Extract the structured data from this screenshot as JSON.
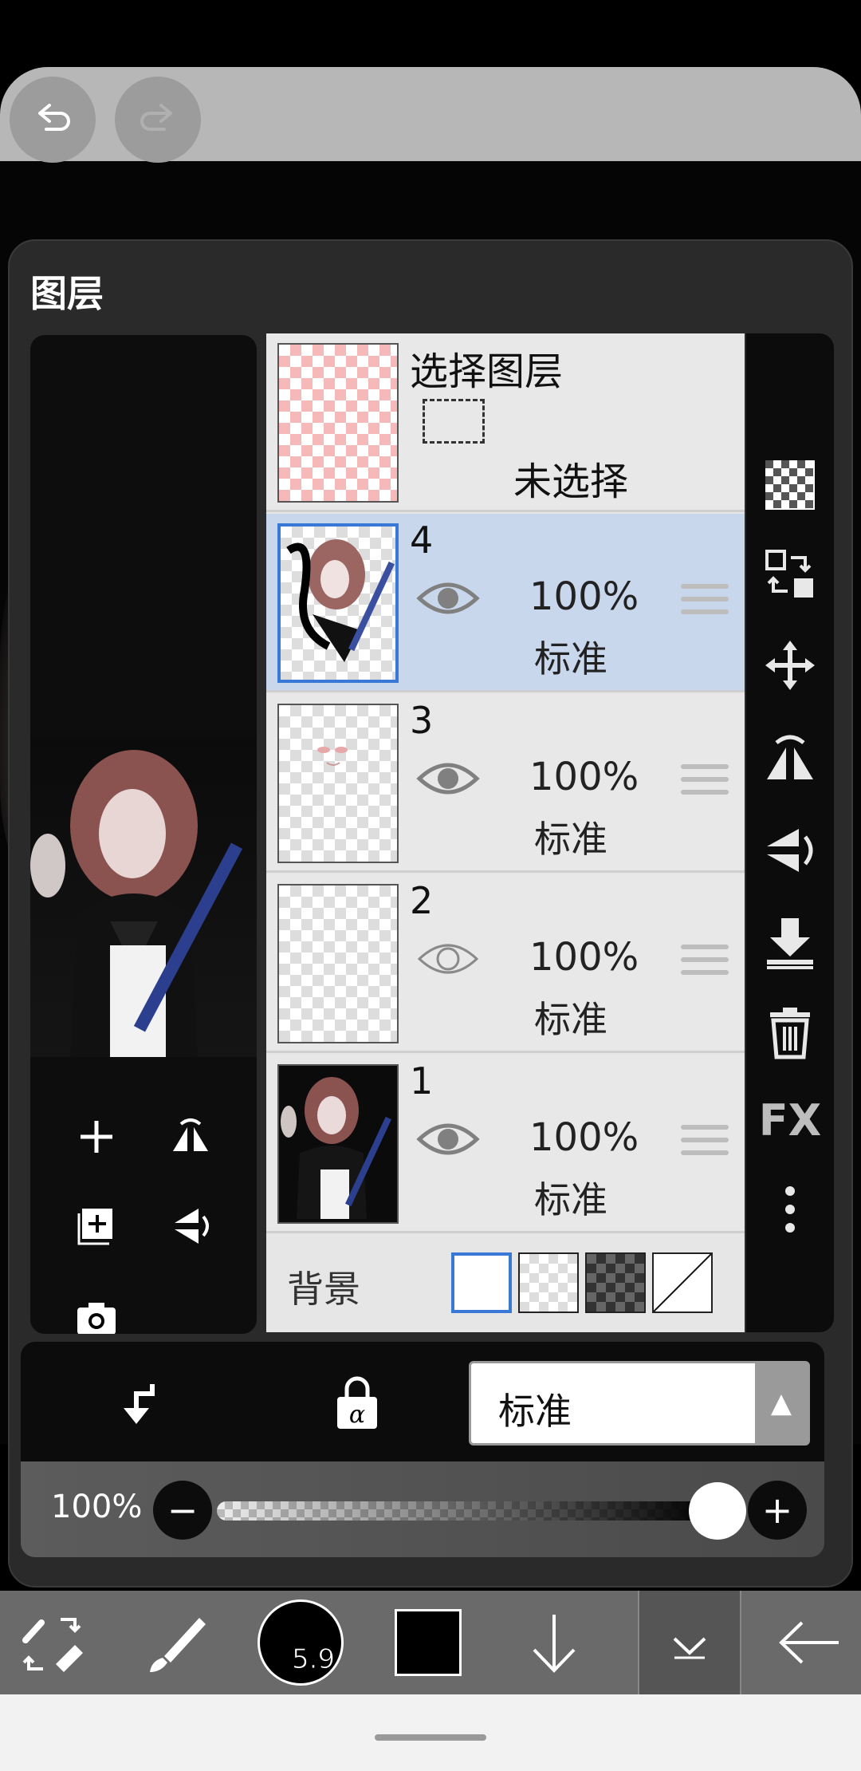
{
  "panel": {
    "title": "图层"
  },
  "selection_layer": {
    "title": "选择图层",
    "state": "未选择"
  },
  "layers": [
    {
      "number": "4",
      "opacity": "100%",
      "blend": "标准",
      "visible": true,
      "active": true
    },
    {
      "number": "3",
      "opacity": "100%",
      "blend": "标准",
      "visible": true,
      "active": false
    },
    {
      "number": "2",
      "opacity": "100%",
      "blend": "标准",
      "visible": false,
      "active": false
    },
    {
      "number": "1",
      "opacity": "100%",
      "blend": "标准",
      "visible": true,
      "active": false
    }
  ],
  "background": {
    "label": "背景"
  },
  "right_tools": {
    "fx_label": "FX",
    "items": [
      "checker-icon",
      "swap-layer-icon",
      "move-icon",
      "flip-horizontal-icon",
      "flip-vertical-icon",
      "merge-down-icon",
      "trash-icon",
      "fx-icon",
      "more-icon"
    ]
  },
  "blend_bar": {
    "mode": "标准"
  },
  "opacity_bar": {
    "label": "100%",
    "value": 1.0,
    "minus": "−",
    "plus": "+"
  },
  "toolbar": {
    "brush_size": "5.9"
  },
  "colors": {
    "accent": "#3a78d6",
    "active_row": "#c9d7ec",
    "toolbar": "#6a6a6a",
    "panel": "#2a2a2a"
  }
}
